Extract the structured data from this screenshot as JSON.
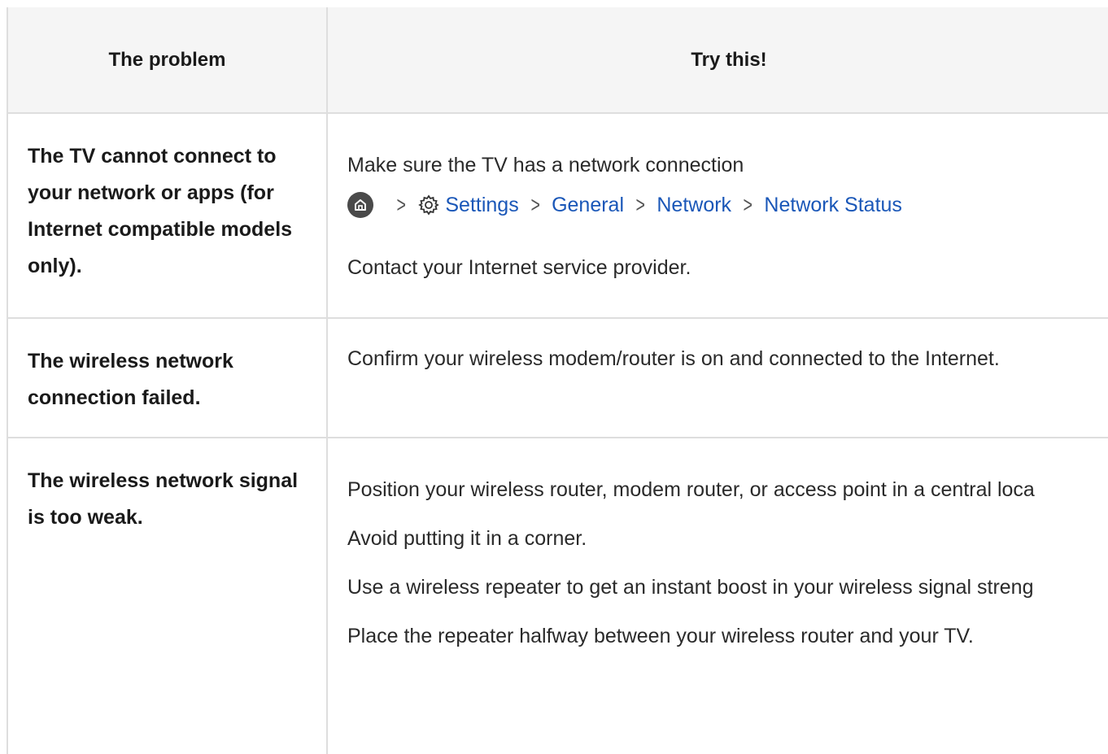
{
  "table": {
    "headers": {
      "problem": "The problem",
      "solution": "Try this!"
    },
    "rows": [
      {
        "problem": "The TV cannot connect to your network or apps (for Internet compatible models only).",
        "solution_intro": "Make sure the TV has a network connection",
        "menu_path": [
          "Settings",
          "General",
          "Network",
          "Network Status"
        ],
        "solution_outro": "Contact your Internet service provider."
      },
      {
        "problem": "The wireless network connection failed.",
        "solution_lines": [
          "Confirm your wireless modem/router is on and connected to the Internet."
        ]
      },
      {
        "problem": "The wireless network signal is too weak.",
        "solution_lines": [
          "Position your wireless router, modem router, or access point in a central loca",
          "Avoid putting it in a corner.",
          "Use a wireless repeater to get an instant boost in your wireless signal streng",
          "Place the repeater halfway between your wireless router and your TV."
        ]
      }
    ]
  },
  "icons": {
    "home": "home-icon",
    "settings": "gear-icon",
    "separator": "chevron-right-icon"
  },
  "colors": {
    "menu_path": "#1a57b8",
    "header_bg": "#f5f5f5",
    "border": "#dedede"
  }
}
